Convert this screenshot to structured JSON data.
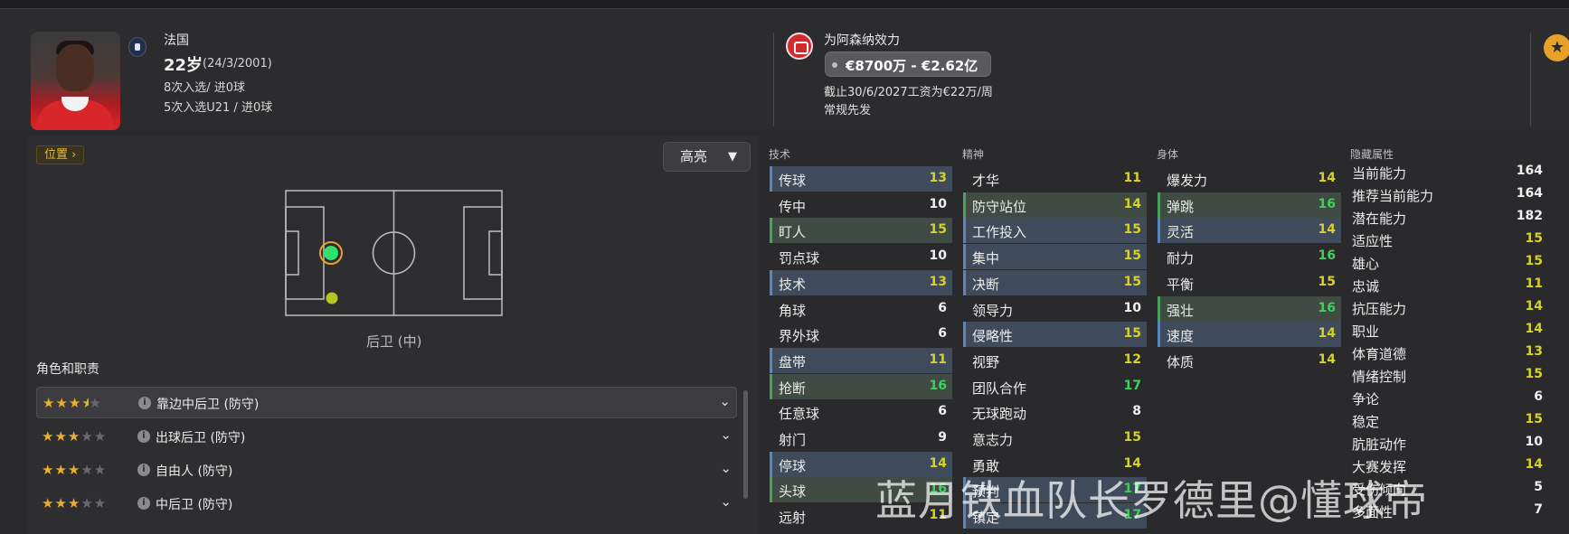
{
  "header": {
    "nationality": "法国",
    "age": "22岁",
    "dob": "(24/3/2001)",
    "caps": "8次入选/ 进0球",
    "u21_caps": "5次入选U21 / 进0球",
    "club_line": "为阿森纳效力",
    "value": "€8700万 - €2.62亿",
    "contract": "截止30/6/2027工资为€22万/周",
    "squad_role": "常规先发",
    "favorite_icon": "star-icon"
  },
  "left": {
    "position_tag": "位置 ›",
    "highlight_label": "高亮",
    "position_name": "后卫 (中)",
    "roles_title": "角色和职责",
    "roles": [
      {
        "name": "靠边中后卫 (防守)",
        "stars": 3.5
      },
      {
        "name": "出球后卫 (防守)",
        "stars": 3
      },
      {
        "name": "自由人 (防守)",
        "stars": 3
      },
      {
        "name": "中后卫 (防守)",
        "stars": 3
      }
    ]
  },
  "attributes": {
    "technical_title": "技术",
    "mental_title": "精神",
    "physical_title": "身体",
    "hidden_title": "隐藏属性",
    "technical": [
      {
        "name": "传球",
        "value": "13"
      },
      {
        "name": "传中",
        "value": "10"
      },
      {
        "name": "盯人",
        "value": "15"
      },
      {
        "name": "罚点球",
        "value": "10"
      },
      {
        "name": "技术",
        "value": "13"
      },
      {
        "name": "角球",
        "value": "6"
      },
      {
        "name": "界外球",
        "value": "6"
      },
      {
        "name": "盘带",
        "value": "11"
      },
      {
        "name": "抢断",
        "value": "16"
      },
      {
        "name": "任意球",
        "value": "6"
      },
      {
        "name": "射门",
        "value": "9"
      },
      {
        "name": "停球",
        "value": "14"
      },
      {
        "name": "头球",
        "value": "16"
      },
      {
        "name": "远射",
        "value": "11"
      }
    ],
    "mental": [
      {
        "name": "才华",
        "value": "11"
      },
      {
        "name": "防守站位",
        "value": "14"
      },
      {
        "name": "工作投入",
        "value": "15"
      },
      {
        "name": "集中",
        "value": "15"
      },
      {
        "name": "决断",
        "value": "15"
      },
      {
        "name": "领导力",
        "value": "10"
      },
      {
        "name": "侵略性",
        "value": "15"
      },
      {
        "name": "视野",
        "value": "12"
      },
      {
        "name": "团队合作",
        "value": "17"
      },
      {
        "name": "无球跑动",
        "value": "8"
      },
      {
        "name": "意志力",
        "value": "15"
      },
      {
        "name": "勇敢",
        "value": "14"
      },
      {
        "name": "预判",
        "value": "17"
      },
      {
        "name": "镇定",
        "value": "17"
      }
    ],
    "physical": [
      {
        "name": "爆发力",
        "value": "14"
      },
      {
        "name": "弹跳",
        "value": "16"
      },
      {
        "name": "灵活",
        "value": "14"
      },
      {
        "name": "耐力",
        "value": "16"
      },
      {
        "name": "平衡",
        "value": "15"
      },
      {
        "name": "强壮",
        "value": "16"
      },
      {
        "name": "速度",
        "value": "14"
      },
      {
        "name": "体质",
        "value": "14"
      }
    ],
    "hidden": [
      {
        "name": "当前能力",
        "value": "164"
      },
      {
        "name": "推荐当前能力",
        "value": "164"
      },
      {
        "name": "潜在能力",
        "value": "182"
      },
      {
        "name": "适应性",
        "value": "15"
      },
      {
        "name": "雄心",
        "value": "15"
      },
      {
        "name": "忠诚",
        "value": "11"
      },
      {
        "name": "抗压能力",
        "value": "14"
      },
      {
        "name": "职业",
        "value": "14"
      },
      {
        "name": "体育道德",
        "value": "13"
      },
      {
        "name": "情绪控制",
        "value": "15"
      },
      {
        "name": "争论",
        "value": "6"
      },
      {
        "name": "稳定",
        "value": "15"
      },
      {
        "name": "肮脏动作",
        "value": "10"
      },
      {
        "name": "大赛发挥",
        "value": "14"
      },
      {
        "name": "受伤倾向",
        "value": "5"
      },
      {
        "name": "多面性",
        "value": "7"
      }
    ]
  },
  "watermark": "蓝月铁血队长罗德里@懂球帝",
  "colors": {
    "accent_gold": "#e8a126",
    "value_green": "#3ed15a",
    "value_yellow": "#d6d22a",
    "value_white": "#f0f0f0",
    "pitch_line": "#bdbdbd",
    "highlight_blue": "#3f4b5a",
    "highlight_green": "#3f4b43"
  }
}
